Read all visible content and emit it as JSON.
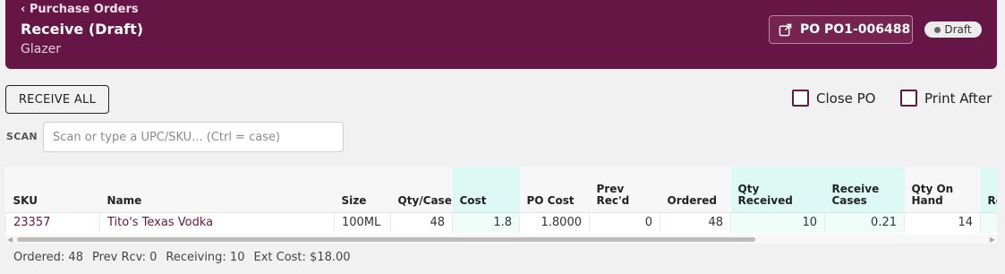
{
  "header": {
    "back_label": "‹ Purchase Orders",
    "title": "Receive (Draft)",
    "vendor": "Glazer",
    "po_button_label": "PO PO1-006488",
    "status": "Draft",
    "color": "#661645"
  },
  "toolbar": {
    "receive_all_label": "RECEIVE ALL",
    "close_po_label": "Close PO",
    "print_after_label": "Print After"
  },
  "scan": {
    "label": "SCAN",
    "placeholder": "Scan or type a UPC/SKU... (Ctrl = case)"
  },
  "table": {
    "columns": [
      "SKU",
      "Name",
      "Size",
      "Qty/Case",
      "Cost",
      "PO Cost",
      "Prev Rec'd",
      "Ordered",
      "Qty Received",
      "Receive Cases",
      "Qty On Hand",
      "Re"
    ],
    "rows": [
      {
        "sku": "23357",
        "name": "Tito's Texas Vodka",
        "size": "100ML",
        "qty_case": "48",
        "cost": "1.8",
        "po_cost": "1.8000",
        "prev_recd": "0",
        "ordered": "48",
        "qty_received": "10",
        "receive_cases": "0.21",
        "qty_on_hand": "14",
        "re": ""
      }
    ]
  },
  "footer": {
    "ordered": "Ordered: 48",
    "prev_rcv": "Prev Rcv: 0",
    "receiving": "Receiving: 10",
    "ext_cost": "Ext Cost: $18.00"
  }
}
